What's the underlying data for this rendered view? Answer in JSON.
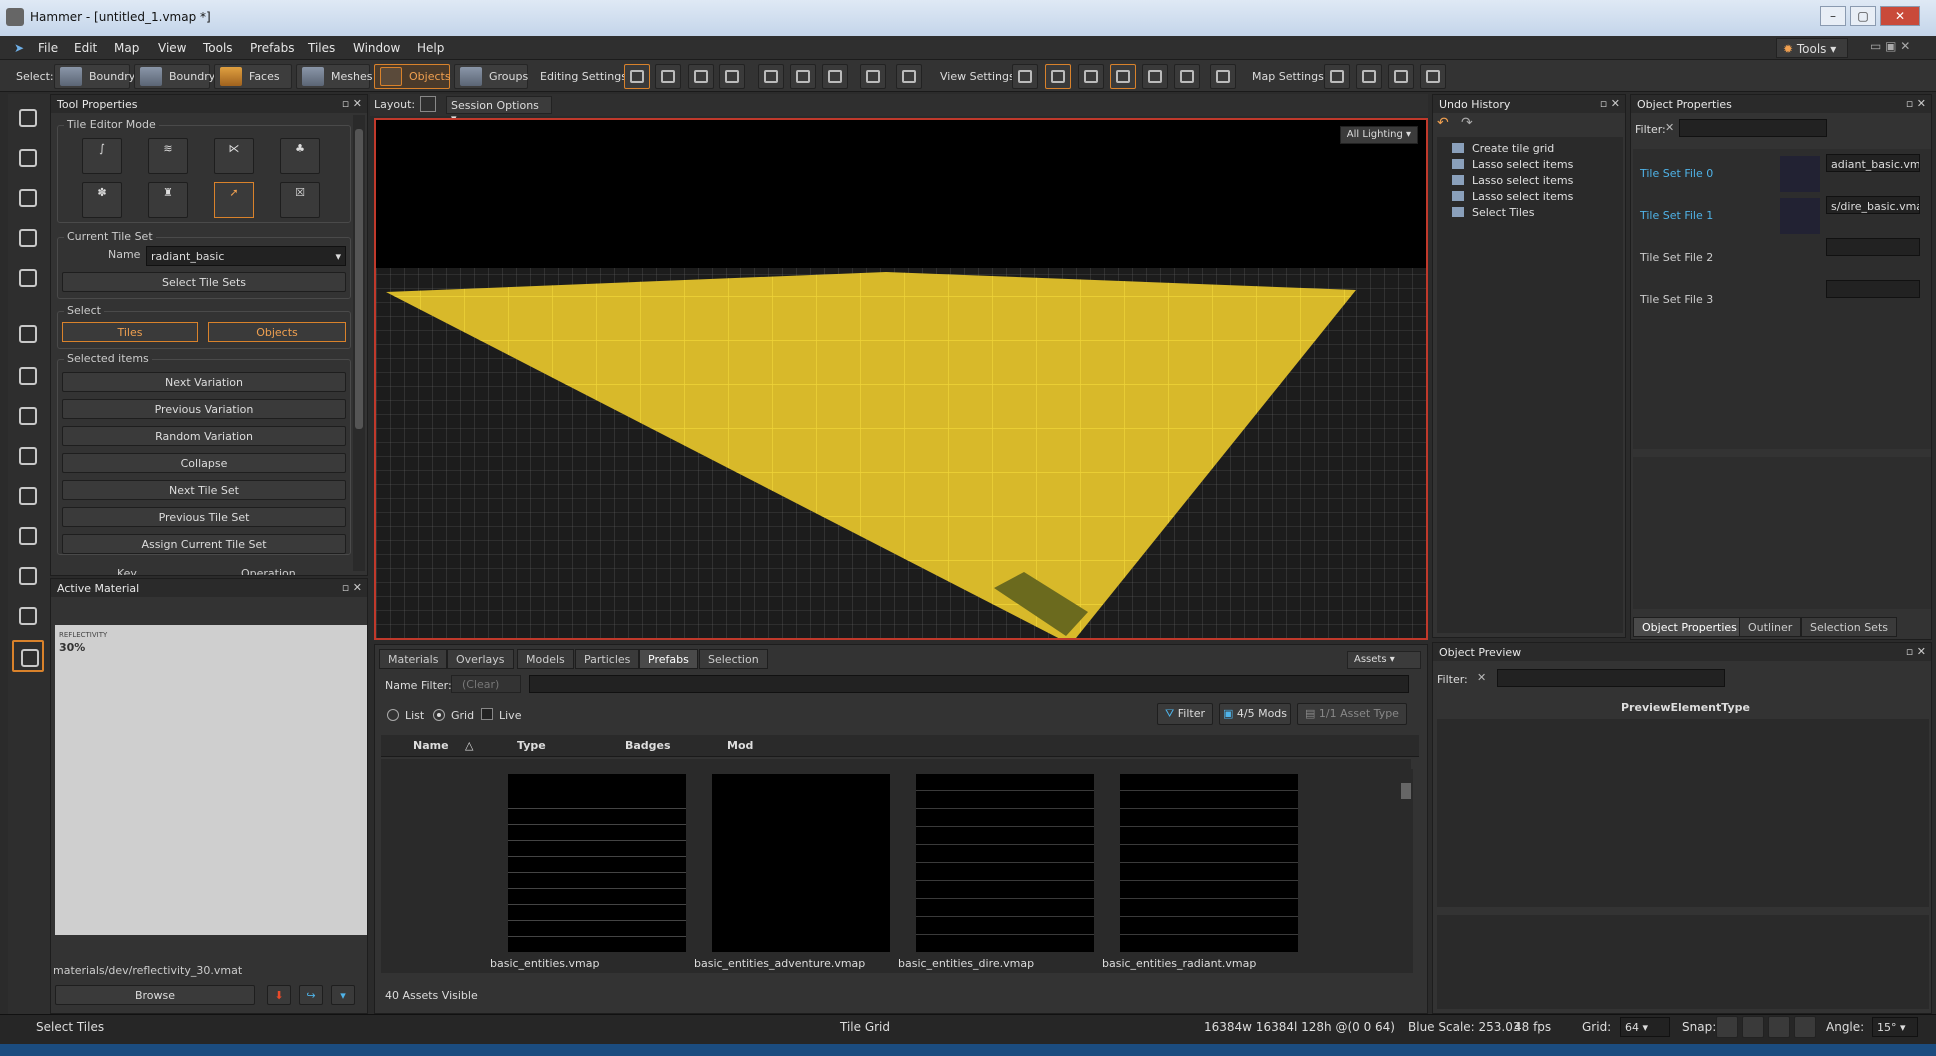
{
  "window": {
    "title": "Hammer - [untitled_1.vmap *]"
  },
  "menu": [
    "File",
    "Edit",
    "Map",
    "View",
    "Tools",
    "Prefabs",
    "Tiles",
    "Window",
    "Help"
  ],
  "tools_button": "Tools",
  "toolbar": {
    "select_label": "Select:",
    "modes": [
      "Boundry",
      "Boundry",
      "Faces",
      "Meshes",
      "Objects",
      "Groups"
    ],
    "editing_label": "Editing Settings:",
    "view_label": "View Settings:",
    "map_label": "Map Settings:"
  },
  "tool_properties": {
    "title": "Tool Properties",
    "tile_editor_mode": "Tile Editor Mode",
    "current_tile_set": "Current Tile Set",
    "name_label": "Name",
    "name_value": "radiant_basic",
    "select_tile_sets": "Select Tile Sets",
    "select_label": "Select",
    "tiles": "Tiles",
    "objects": "Objects",
    "selected_items": "Selected items",
    "actions": [
      "Next Variation",
      "Previous Variation",
      "Random Variation",
      "Collapse",
      "Next Tile Set",
      "Previous Tile Set",
      "Assign Current Tile Set"
    ],
    "key_col": "Key",
    "op_col": "Operation"
  },
  "active_material": {
    "title": "Active Material",
    "swatch_label": "REFLECTIVITY",
    "swatch_value": "30%",
    "path": "materials/dev/reflectivity_30.vmat",
    "browse": "Browse"
  },
  "viewport": {
    "layout_label": "Layout:",
    "session": "Session Options",
    "lighting": "All Lighting"
  },
  "asset_browser": {
    "tabs": [
      "Materials",
      "Overlays",
      "Models",
      "Particles",
      "Prefabs",
      "Selection"
    ],
    "active_tab": "Prefabs",
    "assets_btn": "Assets",
    "name_filter": "Name Filter:",
    "clear": "(Clear)",
    "view_options": [
      "List",
      "Grid",
      "Live"
    ],
    "filter": "Filter",
    "mods": "4/5 Mods",
    "asset_type": "1/1 Asset Type",
    "columns": [
      "Name",
      "Type",
      "Badges",
      "Mod"
    ],
    "items": [
      "basic_entities.vmap",
      "basic_entities_adventure.vmap",
      "basic_entities_dire.vmap",
      "basic_entities_radiant.vmap"
    ],
    "count": "40 Assets Visible"
  },
  "undo_history": {
    "title": "Undo History",
    "items": [
      "Create tile grid",
      "Lasso select items",
      "Lasso select items",
      "Lasso select items",
      "Select Tiles"
    ]
  },
  "object_properties": {
    "title": "Object Properties",
    "filter": "Filter:",
    "tile_sets": [
      {
        "label": "Tile Set File 0",
        "value": "adiant_basic.vmap"
      },
      {
        "label": "Tile Set File 1",
        "value": "s/dire_basic.vmap"
      },
      {
        "label": "Tile Set File 2",
        "value": ""
      },
      {
        "label": "Tile Set File 3",
        "value": ""
      }
    ],
    "tabs": [
      "Object Properties",
      "Outliner",
      "Selection Sets"
    ]
  },
  "object_preview": {
    "title": "Object Preview",
    "filter": "Filter:",
    "type": "PreviewElementType"
  },
  "statusbar": {
    "left": "Select Tiles",
    "mode": "Tile Grid",
    "coords": "16384w 16384l 128h @(0 0 64)",
    "blue_scale": "Blue Scale: 253.03",
    "fps": "48 fps",
    "grid_label": "Grid:",
    "grid_value": "64",
    "snap_label": "Snap:",
    "angle_label": "Angle:",
    "angle_value": "15°"
  },
  "colors": {
    "accent": "#d9822b",
    "selection": "#f5dc2e",
    "viewport_border": "#c0392b",
    "link": "#4fb3e8"
  }
}
